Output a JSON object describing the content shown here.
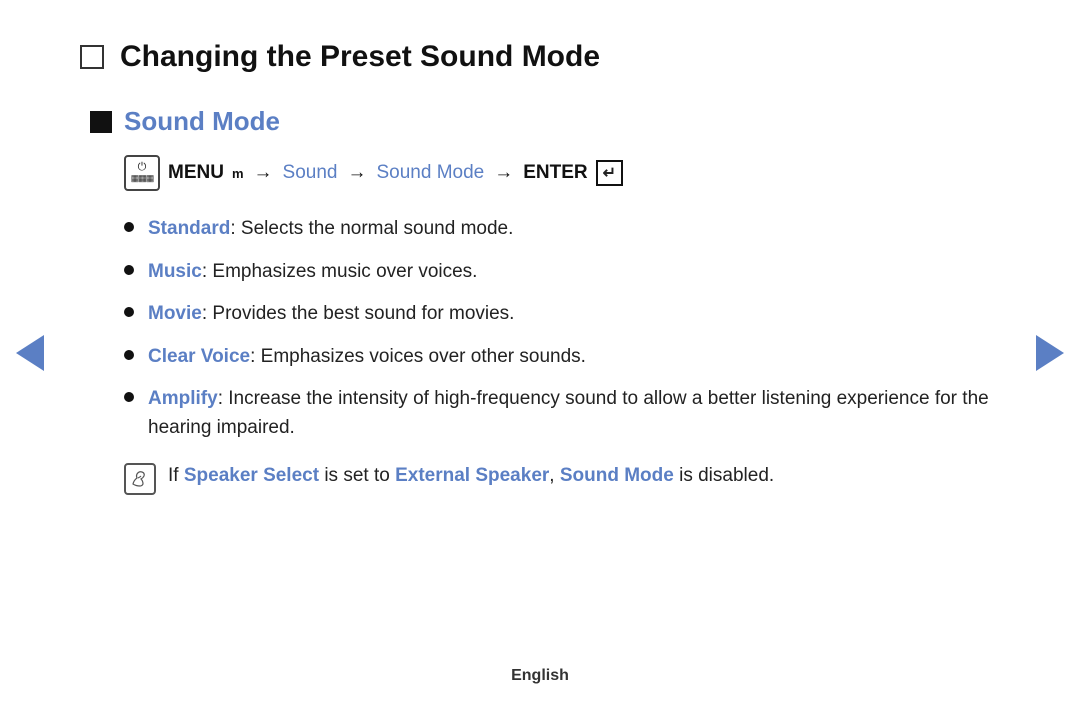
{
  "page": {
    "title": "Changing the Preset Sound Mode",
    "footer": "English"
  },
  "section": {
    "title": "Sound Mode",
    "menu_path": {
      "menu_label": "MENU",
      "menu_suffix": "m",
      "arrow": "→",
      "sound": "Sound",
      "sound_mode": "Sound Mode",
      "enter_label": "ENTER"
    },
    "bullets": [
      {
        "term": "Standard",
        "desc": ": Selects the normal sound mode."
      },
      {
        "term": "Music",
        "desc": ": Emphasizes music over voices."
      },
      {
        "term": "Movie",
        "desc": ": Provides the best sound for movies."
      },
      {
        "term": "Clear Voice",
        "desc": ": Emphasizes voices over other sounds."
      },
      {
        "term": "Amplify",
        "desc": ": Increase the intensity of high-frequency sound to allow a better listening experience for the hearing impaired."
      }
    ],
    "note": {
      "prefix": " If ",
      "speaker_select": "Speaker Select",
      "middle": " is set to ",
      "external_speaker": "External Speaker",
      "comma": ", ",
      "sound_mode": "Sound Mode",
      "suffix": " is disabled."
    }
  },
  "nav": {
    "left_label": "previous",
    "right_label": "next"
  }
}
